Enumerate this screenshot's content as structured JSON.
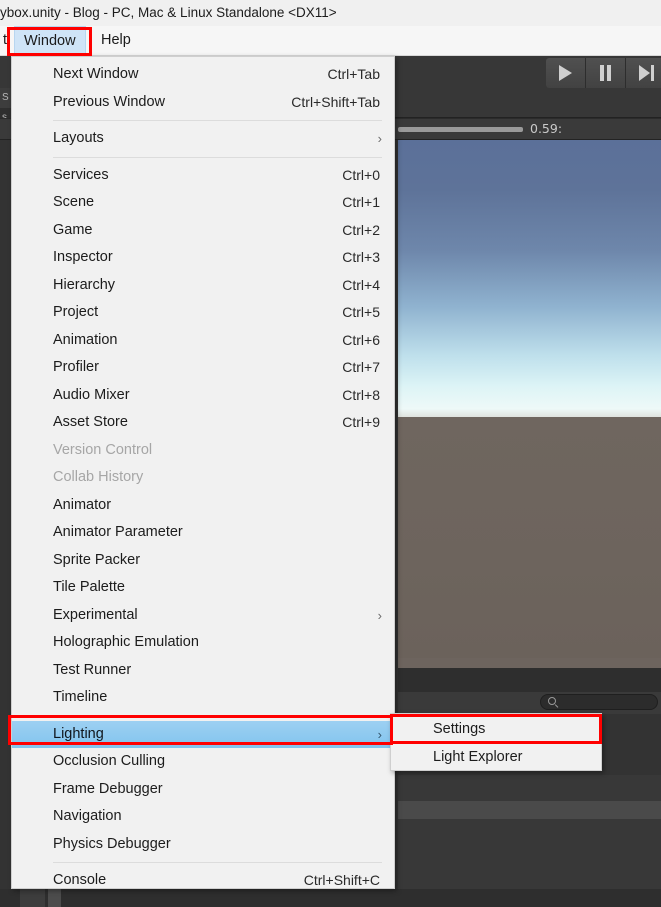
{
  "window": {
    "title": "ybox.unity - Blog - PC, Mac & Linux Standalone <DX11>"
  },
  "menubar": {
    "edit": "t",
    "window": "Window",
    "help": "Help"
  },
  "toolbar": {
    "play_icon": "play-icon",
    "pause_icon": "pause-icon",
    "step_icon": "step-icon",
    "scrub_label": "0.59:"
  },
  "left_tabs": {
    "tab_one": "S",
    "tab_two": "s"
  },
  "search": {
    "icon": "search-icon",
    "value": ""
  },
  "window_menu": {
    "items": [
      {
        "label": "Next Window",
        "shortcut": "Ctrl+Tab",
        "arrow": "",
        "disabled": false,
        "highlight": false,
        "sep_after": false
      },
      {
        "label": "Previous Window",
        "shortcut": "Ctrl+Shift+Tab",
        "arrow": "",
        "disabled": false,
        "highlight": false,
        "sep_after": true
      },
      {
        "label": "Layouts",
        "shortcut": "",
        "arrow": "›",
        "disabled": false,
        "highlight": false,
        "sep_after": true
      },
      {
        "label": "Services",
        "shortcut": "Ctrl+0",
        "arrow": "",
        "disabled": false,
        "highlight": false,
        "sep_after": false
      },
      {
        "label": "Scene",
        "shortcut": "Ctrl+1",
        "arrow": "",
        "disabled": false,
        "highlight": false,
        "sep_after": false
      },
      {
        "label": "Game",
        "shortcut": "Ctrl+2",
        "arrow": "",
        "disabled": false,
        "highlight": false,
        "sep_after": false
      },
      {
        "label": "Inspector",
        "shortcut": "Ctrl+3",
        "arrow": "",
        "disabled": false,
        "highlight": false,
        "sep_after": false
      },
      {
        "label": "Hierarchy",
        "shortcut": "Ctrl+4",
        "arrow": "",
        "disabled": false,
        "highlight": false,
        "sep_after": false
      },
      {
        "label": "Project",
        "shortcut": "Ctrl+5",
        "arrow": "",
        "disabled": false,
        "highlight": false,
        "sep_after": false
      },
      {
        "label": "Animation",
        "shortcut": "Ctrl+6",
        "arrow": "",
        "disabled": false,
        "highlight": false,
        "sep_after": false
      },
      {
        "label": "Profiler",
        "shortcut": "Ctrl+7",
        "arrow": "",
        "disabled": false,
        "highlight": false,
        "sep_after": false
      },
      {
        "label": "Audio Mixer",
        "shortcut": "Ctrl+8",
        "arrow": "",
        "disabled": false,
        "highlight": false,
        "sep_after": false
      },
      {
        "label": "Asset Store",
        "shortcut": "Ctrl+9",
        "arrow": "",
        "disabled": false,
        "highlight": false,
        "sep_after": false
      },
      {
        "label": "Version Control",
        "shortcut": "",
        "arrow": "",
        "disabled": true,
        "highlight": false,
        "sep_after": false
      },
      {
        "label": "Collab History",
        "shortcut": "",
        "arrow": "",
        "disabled": true,
        "highlight": false,
        "sep_after": false
      },
      {
        "label": "Animator",
        "shortcut": "",
        "arrow": "",
        "disabled": false,
        "highlight": false,
        "sep_after": false
      },
      {
        "label": "Animator Parameter",
        "shortcut": "",
        "arrow": "",
        "disabled": false,
        "highlight": false,
        "sep_after": false
      },
      {
        "label": "Sprite Packer",
        "shortcut": "",
        "arrow": "",
        "disabled": false,
        "highlight": false,
        "sep_after": false
      },
      {
        "label": "Tile Palette",
        "shortcut": "",
        "arrow": "",
        "disabled": false,
        "highlight": false,
        "sep_after": false
      },
      {
        "label": "Experimental",
        "shortcut": "",
        "arrow": "›",
        "disabled": false,
        "highlight": false,
        "sep_after": false
      },
      {
        "label": "Holographic Emulation",
        "shortcut": "",
        "arrow": "",
        "disabled": false,
        "highlight": false,
        "sep_after": false
      },
      {
        "label": "Test Runner",
        "shortcut": "",
        "arrow": "",
        "disabled": false,
        "highlight": false,
        "sep_after": false
      },
      {
        "label": "Timeline",
        "shortcut": "",
        "arrow": "",
        "disabled": false,
        "highlight": false,
        "sep_after": true
      },
      {
        "label": "Lighting",
        "shortcut": "",
        "arrow": "›",
        "disabled": false,
        "highlight": true,
        "sep_after": false
      },
      {
        "label": "Occlusion Culling",
        "shortcut": "",
        "arrow": "",
        "disabled": false,
        "highlight": false,
        "sep_after": false
      },
      {
        "label": "Frame Debugger",
        "shortcut": "",
        "arrow": "",
        "disabled": false,
        "highlight": false,
        "sep_after": false
      },
      {
        "label": "Navigation",
        "shortcut": "",
        "arrow": "",
        "disabled": false,
        "highlight": false,
        "sep_after": false
      },
      {
        "label": "Physics Debugger",
        "shortcut": "",
        "arrow": "",
        "disabled": false,
        "highlight": false,
        "sep_after": true
      },
      {
        "label": "Console",
        "shortcut": "Ctrl+Shift+C",
        "arrow": "",
        "disabled": false,
        "highlight": false,
        "sep_after": false
      }
    ]
  },
  "lighting_submenu": {
    "items": [
      {
        "label": "Settings",
        "shortcut": "",
        "arrow": "",
        "disabled": false,
        "highlight": false
      },
      {
        "label": "Light Explorer",
        "shortcut": "",
        "arrow": "",
        "disabled": false,
        "highlight": false
      }
    ]
  },
  "annotations": {
    "color": "#ff0000",
    "boxes": [
      "window-menu-button",
      "lighting-menu-item",
      "settings-submenu-item"
    ]
  },
  "colors": {
    "highlight": "#8fc9f0",
    "menu_bg": "#f1f1f1",
    "editor_bg": "#383838",
    "sky_top": "#5b7099",
    "sky_horizon": "#eef9f8",
    "ground": "#6d645d"
  }
}
